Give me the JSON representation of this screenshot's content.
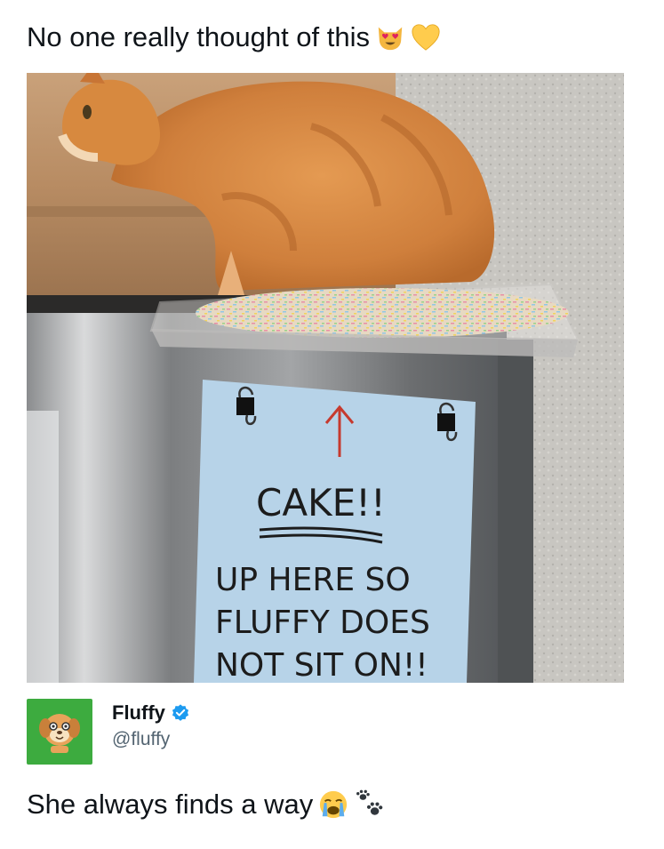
{
  "post": {
    "caption": "No one really thought of this",
    "caption_emojis": [
      "smiling-cat-heart-eyes-emoji",
      "yellow-heart-emoji"
    ],
    "reply_text": "She always finds a way",
    "reply_emojis": [
      "crying-face-emoji",
      "paw-prints-emoji"
    ]
  },
  "author": {
    "name": "Fluffy",
    "handle": "@fluffy",
    "verified": true,
    "avatar_bg": "#3dab3f"
  },
  "photo": {
    "sign": {
      "arrow": "↑",
      "headline": "CAKE!!",
      "line1": "UP HERE SO",
      "line2": "FLUFFY DOES",
      "line3": "NOT SIT ON!!",
      "paper_color": "#b7d3e8"
    }
  },
  "colors": {
    "text": "#0f1419",
    "handle": "#536471",
    "verified_blue": "#1d9bf0"
  }
}
